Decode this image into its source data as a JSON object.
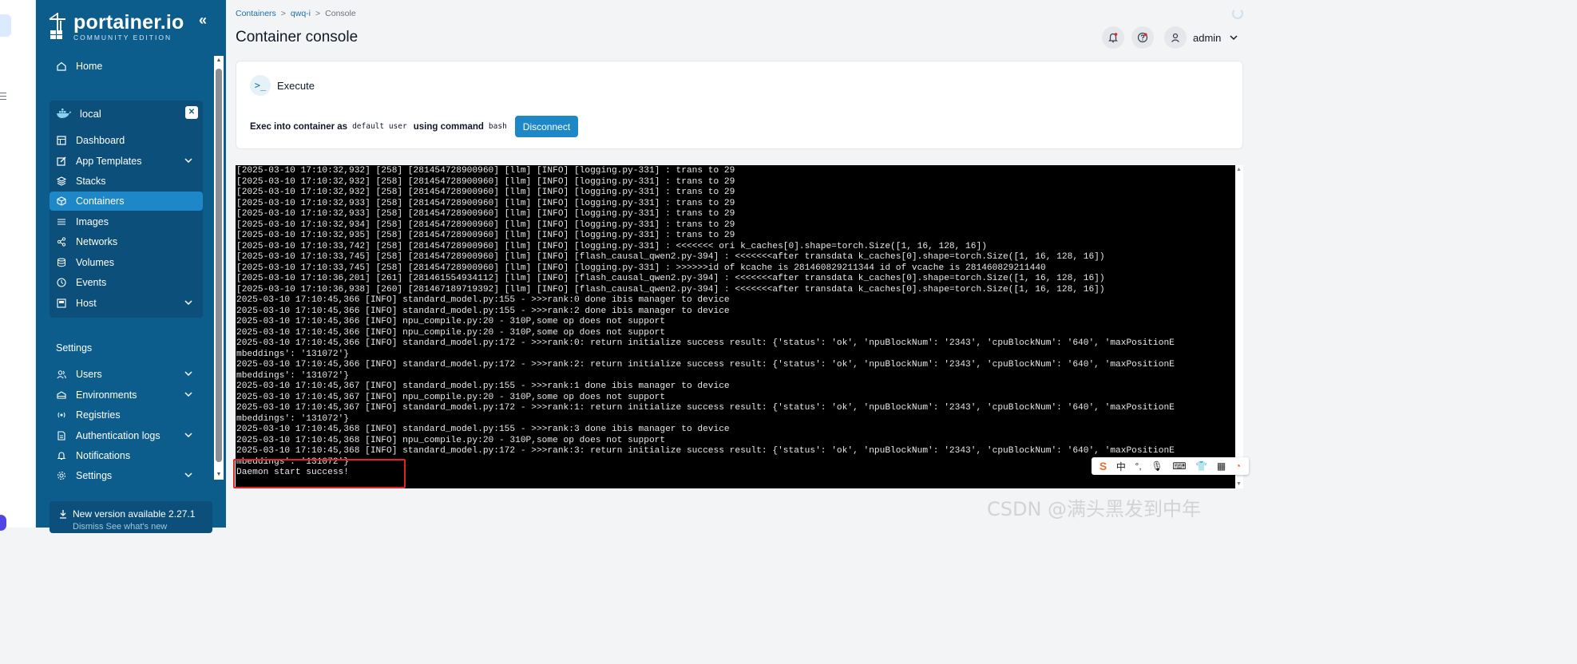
{
  "sidebar": {
    "brand_name": "portainer.io",
    "brand_edition": "COMMUNITY EDITION",
    "home": "Home",
    "environment": "local",
    "env_items": [
      {
        "label": "Dashboard",
        "icon": "dashboard-icon"
      },
      {
        "label": "App Templates",
        "icon": "edit-icon",
        "expandable": true
      },
      {
        "label": "Stacks",
        "icon": "stacks-icon"
      },
      {
        "label": "Containers",
        "icon": "cube-icon",
        "active": true
      },
      {
        "label": "Images",
        "icon": "list-icon"
      },
      {
        "label": "Networks",
        "icon": "share-icon"
      },
      {
        "label": "Volumes",
        "icon": "database-icon"
      },
      {
        "label": "Events",
        "icon": "clock-icon"
      },
      {
        "label": "Host",
        "icon": "host-icon",
        "expandable": true
      }
    ],
    "settings_title": "Settings",
    "settings_items": [
      {
        "label": "Users",
        "icon": "users-icon",
        "expandable": true
      },
      {
        "label": "Environments",
        "icon": "environments-icon",
        "expandable": true
      },
      {
        "label": "Registries",
        "icon": "radio-icon"
      },
      {
        "label": "Authentication logs",
        "icon": "file-icon",
        "expandable": true
      },
      {
        "label": "Notifications",
        "icon": "bell-icon"
      },
      {
        "label": "Settings",
        "icon": "gear-icon",
        "expandable": true
      }
    ],
    "update_text": "New version available 2.27.1",
    "update_sub": "Dismiss   See what's new"
  },
  "header": {
    "breadcrumb": [
      "Containers",
      "qwq-i",
      "Console"
    ],
    "title": "Container console",
    "user": "admin"
  },
  "exec": {
    "title": "Execute",
    "label_prefix": "Exec into container as",
    "user": "default user",
    "label_mid": "using command",
    "command": "bash",
    "button": "Disconnect"
  },
  "terminal": {
    "lines": [
      "[2025-03-10 17:10:32,932] [258] [281454728900960] [llm] [INFO] [logging.py-331] : trans to 29",
      "[2025-03-10 17:10:32,932] [258] [281454728900960] [llm] [INFO] [logging.py-331] : trans to 29",
      "[2025-03-10 17:10:32,932] [258] [281454728900960] [llm] [INFO] [logging.py-331] : trans to 29",
      "[2025-03-10 17:10:32,933] [258] [281454728900960] [llm] [INFO] [logging.py-331] : trans to 29",
      "[2025-03-10 17:10:32,933] [258] [281454728900960] [llm] [INFO] [logging.py-331] : trans to 29",
      "[2025-03-10 17:10:32,934] [258] [281454728900960] [llm] [INFO] [logging.py-331] : trans to 29",
      "[2025-03-10 17:10:32,935] [258] [281454728900960] [llm] [INFO] [logging.py-331] : trans to 29",
      "[2025-03-10 17:10:33,742] [258] [281454728900960] [llm] [INFO] [logging.py-331] : <<<<<<< ori k_caches[0].shape=torch.Size([1, 16, 128, 16])",
      "[2025-03-10 17:10:33,745] [258] [281454728900960] [llm] [INFO] [flash_causal_qwen2.py-394] : <<<<<<<after transdata k_caches[0].shape=torch.Size([1, 16, 128, 16])",
      "[2025-03-10 17:10:33,745] [258] [281454728900960] [llm] [INFO] [logging.py-331] : >>>>>>id of kcache is 281460829211344 id of vcache is 281460829211440",
      "[2025-03-10 17:10:36,201] [261] [281461554934112] [llm] [INFO] [flash_causal_qwen2.py-394] : <<<<<<<after transdata k_caches[0].shape=torch.Size([1, 16, 128, 16])",
      "[2025-03-10 17:10:36,938] [260] [281467189719392] [llm] [INFO] [flash_causal_qwen2.py-394] : <<<<<<<after transdata k_caches[0].shape=torch.Size([1, 16, 128, 16])",
      "2025-03-10 17:10:45,366 [INFO] standard_model.py:155 - >>>rank:0 done ibis manager to device",
      "2025-03-10 17:10:45,366 [INFO] standard_model.py:155 - >>>rank:2 done ibis manager to device",
      "2025-03-10 17:10:45,366 [INFO] npu_compile.py:20 - 310P,some op does not support",
      "2025-03-10 17:10:45,366 [INFO] npu_compile.py:20 - 310P,some op does not support",
      "2025-03-10 17:10:45,366 [INFO] standard_model.py:172 - >>>rank:0: return initialize success result: {'status': 'ok', 'npuBlockNum': '2343', 'cpuBlockNum': '640', 'maxPositionE",
      "mbeddings': '131072'}",
      "2025-03-10 17:10:45,366 [INFO] standard_model.py:172 - >>>rank:2: return initialize success result: {'status': 'ok', 'npuBlockNum': '2343', 'cpuBlockNum': '640', 'maxPositionE",
      "mbeddings': '131072'}",
      "2025-03-10 17:10:45,367 [INFO] standard_model.py:155 - >>>rank:1 done ibis manager to device",
      "2025-03-10 17:10:45,367 [INFO] npu_compile.py:20 - 310P,some op does not support",
      "2025-03-10 17:10:45,367 [INFO] standard_model.py:172 - >>>rank:1: return initialize success result: {'status': 'ok', 'npuBlockNum': '2343', 'cpuBlockNum': '640', 'maxPositionE",
      "mbeddings': '131072'}",
      "2025-03-10 17:10:45,368 [INFO] standard_model.py:155 - >>>rank:3 done ibis manager to device",
      "2025-03-10 17:10:45,368 [INFO] npu_compile.py:20 - 310P,some op does not support",
      "2025-03-10 17:10:45,368 [INFO] standard_model.py:172 - >>>rank:3: return initialize success result: {'status': 'ok', 'npuBlockNum': '2343', 'cpuBlockNum': '640', 'maxPositionE",
      "mbeddings': '131072'}",
      "Daemon start success!"
    ]
  },
  "ime_toolbar": [
    "S",
    "中",
    "°,",
    "mic",
    "keyboard",
    "shirt",
    "apps",
    "skin"
  ],
  "watermark": "CSDN @满头黑发到中年",
  "colors": {
    "sidebar": "#0d5d8c",
    "accent": "#1d87c8",
    "highlight": "#e02424"
  }
}
